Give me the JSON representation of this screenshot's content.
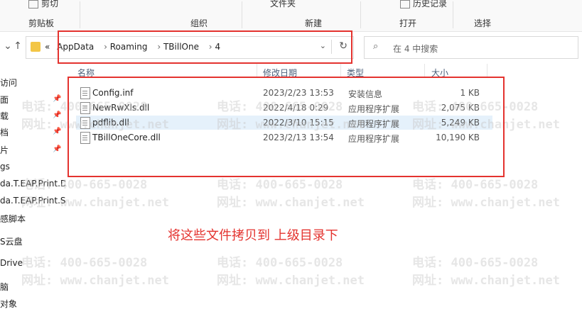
{
  "ribbon": {
    "top": [
      "剪切",
      "文件夹",
      "历史记录"
    ],
    "groups": [
      "剪贴板",
      "组织",
      "新建",
      "打开",
      "选择"
    ]
  },
  "nav": {
    "up_icon": "up-arrow-icon",
    "crumbs": [
      "«",
      "AppData",
      "Roaming",
      "TBillOne",
      "4"
    ],
    "dropdown_icon": "chevron-down-icon",
    "refresh_icon": "refresh-icon",
    "search_placeholder": "在 4 中搜索"
  },
  "sidebar": {
    "items": [
      "访问",
      "面",
      "载",
      "档",
      "片",
      "gs",
      "da.T.EAP.Print.D",
      "da.T.EAP.Print.S",
      "感脚本",
      "S云盘",
      "Drive",
      "脑",
      "对象"
    ]
  },
  "columns": [
    "名称",
    "修改日期",
    "类型",
    "大小"
  ],
  "files": [
    {
      "name": "Config.inf",
      "date": "2023/2/23 13:53",
      "type": "安装信息",
      "size": "1 KB"
    },
    {
      "name": "NewRwXls.dll",
      "date": "2022/4/18 0:29",
      "type": "应用程序扩展",
      "size": "2,075 KB"
    },
    {
      "name": "pdflib.dll",
      "date": "2022/3/10 15:15",
      "type": "应用程序扩展",
      "size": "5,249 KB"
    },
    {
      "name": "TBillOneCore.dll",
      "date": "2023/2/13 13:54",
      "type": "应用程序扩展",
      "size": "10,190 KB"
    }
  ],
  "annotation": "将这些文件拷贝到  上级目录下",
  "watermark": {
    "phone": "电话: 400-665-0028",
    "site": "网址: www.chanjet.net"
  },
  "colors": {
    "annotation_red": "#e4332f",
    "selected_row": "#e5f1fb",
    "folder": "#f3c646"
  }
}
